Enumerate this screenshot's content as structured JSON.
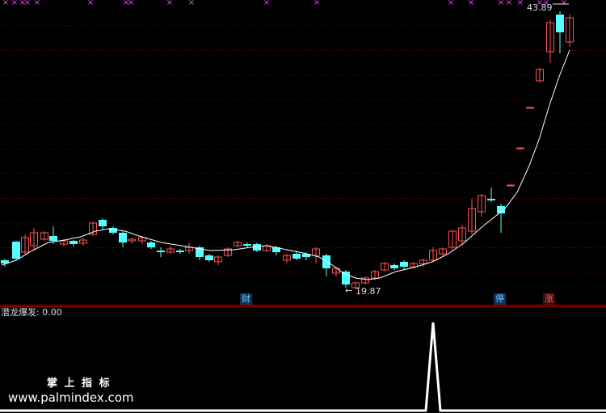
{
  "main_chart": {
    "price_high_label": "43.89",
    "price_low_label": "19.87",
    "low_arrow": "←",
    "top_markers": "×",
    "signals": [
      {
        "label": "财",
        "color": "#5fd0ff"
      },
      {
        "label": "停",
        "color": "#5fd0ff"
      },
      {
        "label": "涨",
        "color": "#ff6060"
      }
    ]
  },
  "indicator": {
    "title": "潜龙爆发",
    "value_text": ": 0.00"
  },
  "watermark": {
    "brand": "掌 上 指 标",
    "url": "www.palmindex.com"
  },
  "colors": {
    "up": "#ff4f4f",
    "down": "#54ffff",
    "grid": "#8b0000",
    "ma": "#ffffff",
    "marker": "#ff40ff"
  }
}
